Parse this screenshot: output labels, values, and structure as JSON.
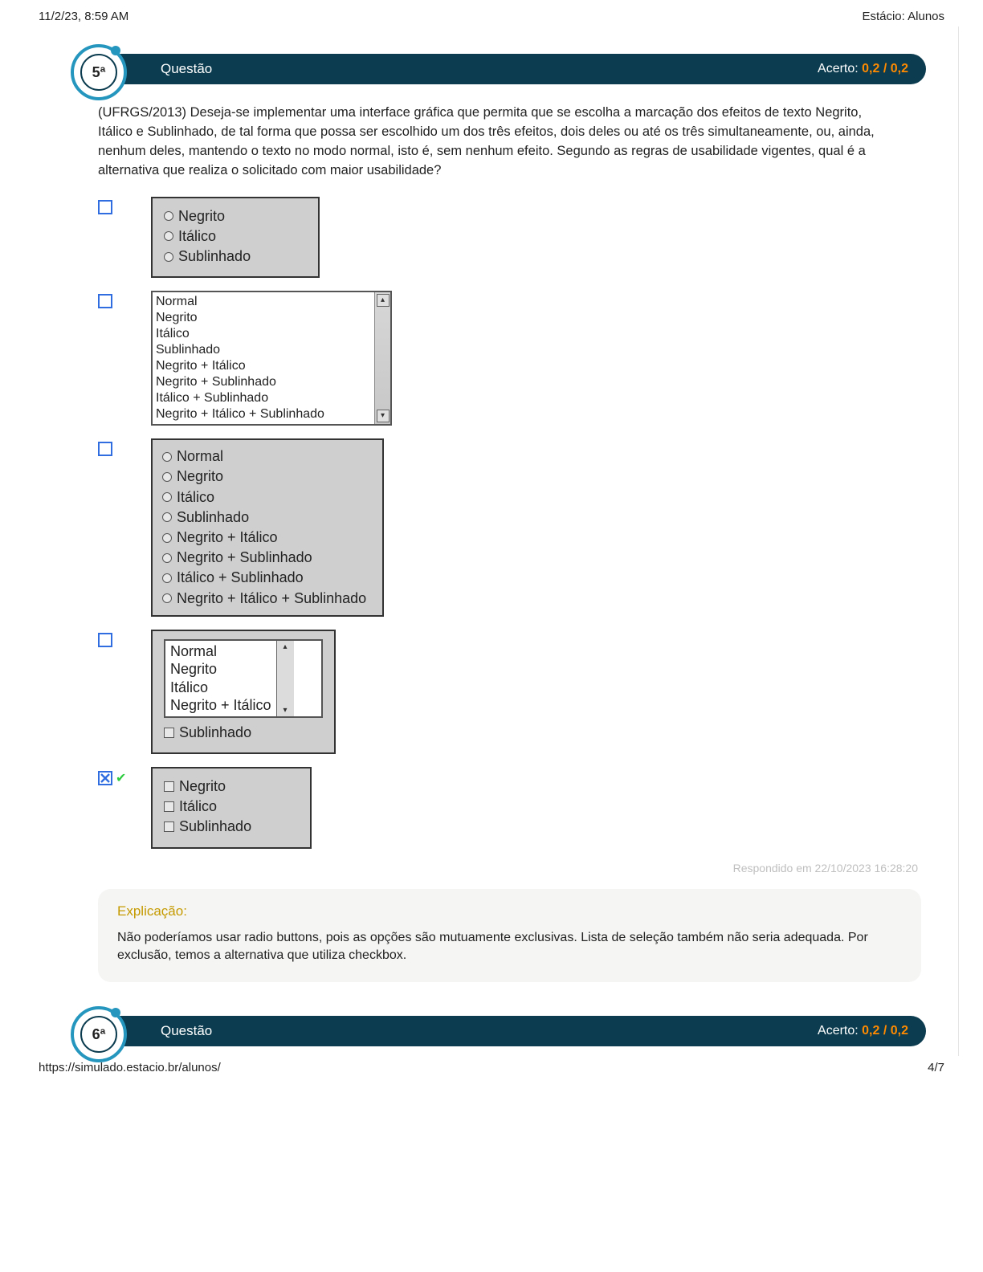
{
  "print": {
    "datetime": "11/2/23, 8:59 AM",
    "title": "Estácio: Alunos"
  },
  "footer": {
    "url": "https://simulado.estacio.br/alunos/",
    "page": "4/7"
  },
  "q5": {
    "badge": "5ª",
    "label": "Questão",
    "acerto_label": "Acerto:",
    "score": "0,2",
    "score_sep": " / ",
    "score_max": "0,2",
    "stem": "(UFRGS/2013) Deseja-se implementar uma interface gráfica que permita que se escolha a marcação dos efeitos de texto Negrito, Itálico e Sublinhado, de tal forma que possa ser escolhido um dos três efeitos, dois deles ou até os três simultaneamente, ou, ainda, nenhum deles, mantendo o texto no modo normal, isto é, sem nenhum efeito. Segundo as regras de usabilidade vigentes, qual é a alternativa que realiza o solicitado com maior usabilidade?",
    "optA": {
      "items": [
        "Negrito",
        "Itálico",
        "Sublinhado"
      ]
    },
    "optB": {
      "items": [
        "Normal",
        "Negrito",
        "Itálico",
        "Sublinhado",
        "Negrito + Itálico",
        "Negrito + Sublinhado",
        "Itálico + Sublinhado",
        "Negrito + Itálico + Sublinhado"
      ]
    },
    "optC": {
      "items": [
        "Normal",
        "Negrito",
        "Itálico",
        "Sublinhado",
        "Negrito + Itálico",
        "Negrito + Sublinhado",
        "Itálico + Sublinhado",
        "Negrito + Itálico + Sublinhado"
      ]
    },
    "optD": {
      "combo": [
        "Normal",
        "Negrito",
        "Itálico",
        "Negrito + Itálico"
      ],
      "check": "Sublinhado"
    },
    "optE": {
      "items": [
        "Negrito",
        "Itálico",
        "Sublinhado"
      ]
    },
    "responded": "Respondido em 22/10/2023 16:28:20",
    "expl_h": "Explicação:",
    "expl_t": "Não poderíamos usar radio buttons, pois as opções são mutuamente exclusivas. Lista de seleção também não seria adequada. Por exclusão, temos a alternativa que utiliza checkbox."
  },
  "q6": {
    "badge": "6ª",
    "label": "Questão",
    "acerto_label": "Acerto:",
    "score": "0,2",
    "score_sep": " / ",
    "score_max": "0,2"
  }
}
